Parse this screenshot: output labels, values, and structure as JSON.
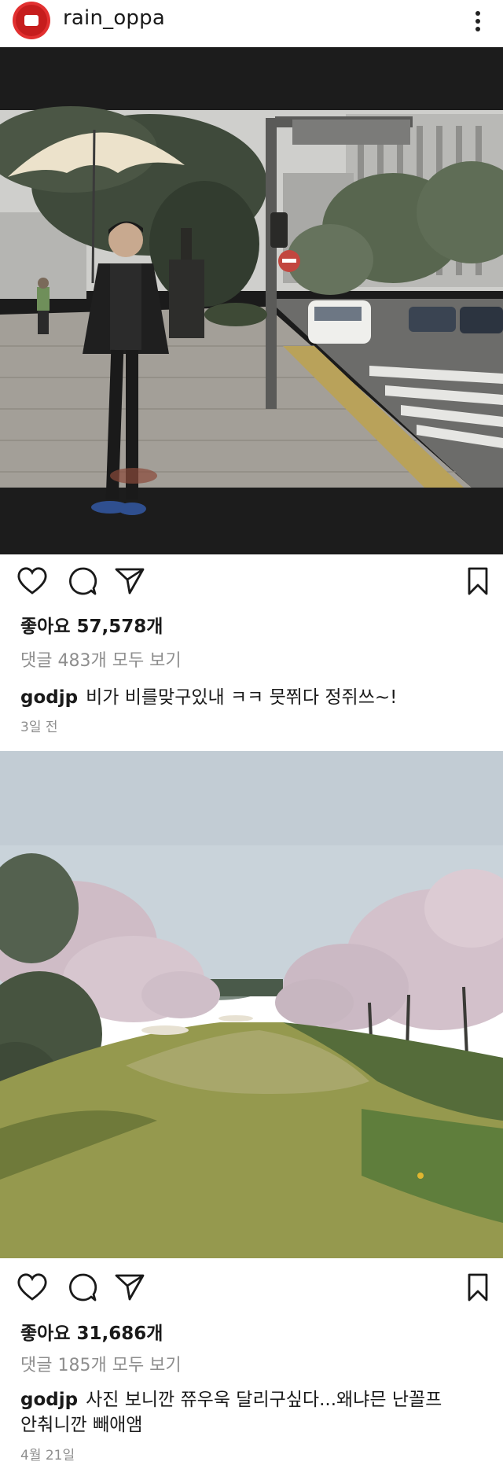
{
  "header": {
    "username": "rain_oppa",
    "avatar_icon": "record-logo-icon",
    "more_icon": "vertical-dots-icon"
  },
  "posts": [
    {
      "image_description_icon": "photo",
      "likes_label": "좋아요 57,578개",
      "comments_link": "댓글 483개 모두 보기",
      "caption_user": "godjp",
      "caption_text": "비가 비를맞구있내 ㅋㅋ 뭇쮜다 정쥐쓰~!",
      "time": "3일 전"
    },
    {
      "image_description_icon": "photo",
      "likes_label": "좋아요 31,686개",
      "comments_link": "댓글 185개 모두 보기",
      "caption_user": "godjp",
      "caption_text_line1": "사진 보니깐 쮸우욱 달리구싶다...왜냐믄 난꼴프",
      "caption_text_line2": "안춰니깐 빼애앰",
      "time": "4월 21일"
    }
  ],
  "icons": [
    "heart-icon",
    "comment-icon",
    "share-icon",
    "bookmark-icon"
  ],
  "colors": {
    "text": "#262626",
    "muted": "#8e8e8e",
    "avatar": "#e23030"
  }
}
